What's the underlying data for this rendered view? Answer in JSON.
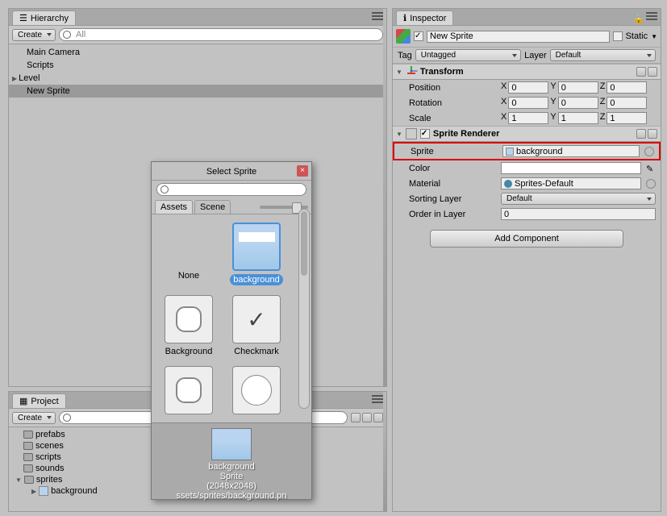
{
  "hierarchy": {
    "title": "Hierarchy",
    "create": "Create",
    "searchPrefix": "All",
    "items": [
      "Main Camera",
      "Scripts",
      "Level",
      "New Sprite"
    ]
  },
  "project": {
    "title": "Project",
    "create": "Create",
    "folders": [
      "prefabs",
      "scenes",
      "scripts",
      "sounds",
      "sprites"
    ],
    "spriteItem": "background"
  },
  "inspector": {
    "title": "Inspector",
    "objectName": "New Sprite",
    "staticLabel": "Static",
    "tagLabel": "Tag",
    "tagValue": "Untagged",
    "layerLabel": "Layer",
    "layerValue": "Default",
    "transform": {
      "title": "Transform",
      "position": {
        "label": "Position",
        "x": "0",
        "y": "0",
        "z": "0"
      },
      "rotation": {
        "label": "Rotation",
        "x": "0",
        "y": "0",
        "z": "0"
      },
      "scale": {
        "label": "Scale",
        "x": "1",
        "y": "1",
        "z": "1"
      }
    },
    "spriteRenderer": {
      "title": "Sprite Renderer",
      "spriteLabel": "Sprite",
      "spriteValue": "background",
      "colorLabel": "Color",
      "materialLabel": "Material",
      "materialValue": "Sprites-Default",
      "sortingLayerLabel": "Sorting Layer",
      "sortingLayerValue": "Default",
      "orderLabel": "Order in Layer",
      "orderValue": "0"
    },
    "addComponent": "Add Component"
  },
  "popup": {
    "title": "Select Sprite",
    "tabs": [
      "Assets",
      "Scene"
    ],
    "items": [
      "None",
      "background",
      "Background",
      "Checkmark"
    ],
    "footer": {
      "name": "background",
      "type": "Sprite",
      "dims": "(2048x2048)",
      "path": "ssets/sprites/background.pn"
    }
  }
}
